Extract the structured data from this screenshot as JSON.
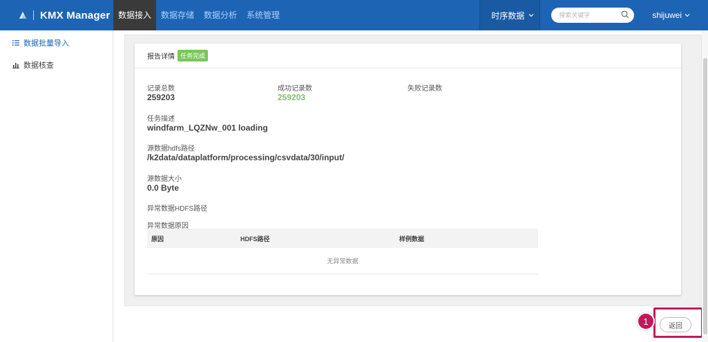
{
  "app": {
    "title": "KMX Manager"
  },
  "nav": {
    "items": [
      {
        "label": "数据接入",
        "active": true
      },
      {
        "label": "数据存储",
        "active": false
      },
      {
        "label": "数据分析",
        "active": false
      },
      {
        "label": "系统管理",
        "active": false
      }
    ]
  },
  "toolbar": {
    "db_select": "时序数据",
    "search_placeholder": "搜索关键字",
    "user": "shijuwei"
  },
  "sidebar": {
    "items": [
      {
        "label": "数据批量导入",
        "icon": "list-icon",
        "active": true
      },
      {
        "label": "数据核查",
        "icon": "bar-chart-icon",
        "active": false
      }
    ]
  },
  "report": {
    "title": "报告详情",
    "status_badge": "任务完成",
    "total_label": "记录总数",
    "total_value": "259203",
    "success_label": "成功记录数",
    "success_value": "259203",
    "fail_label": "失败记录数",
    "fail_value": "",
    "desc_label": "任务描述",
    "desc_value": "windfarm_LQZNw_001 loading",
    "hdfs_label": "源数据hdfs路径",
    "hdfs_value": "/k2data/dataplatform/processing/csvdata/30/input/",
    "size_label": "源数据大小",
    "size_value": "0.0 Byte",
    "err_hdfs_label": "异常数据HDFS路径",
    "err_reason_label": "异常数据原因",
    "table": {
      "columns": [
        "原因",
        "HDFS路径",
        "样例数据"
      ],
      "empty_text": "无异常数据"
    }
  },
  "footer": {
    "back_label": "返回",
    "step_number": "1"
  },
  "colors": {
    "nav_bg": "#1e64b4",
    "active_tab": "#3a3a3a",
    "success_green": "#7cc55a",
    "highlight": "#c2185b"
  }
}
